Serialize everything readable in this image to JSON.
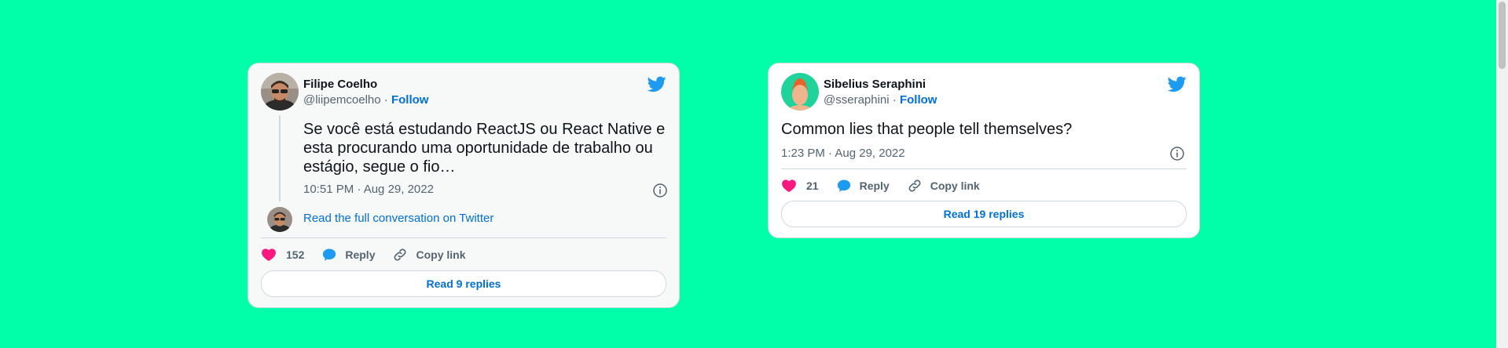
{
  "tweets": [
    {
      "name": "Filipe Coelho",
      "handle": "@liipemcoelho",
      "separator": "·",
      "follow": "Follow",
      "text": "Se você está estudando ReactJS ou React Native e esta procurando uma oportunidade de trabalho ou estágio, segue o fio…",
      "time": "10:51 PM · Aug 29, 2022",
      "conversation_link": "Read the full conversation on Twitter",
      "likes": "152",
      "reply": "Reply",
      "copy_link": "Copy link",
      "read_replies": "Read 9 replies"
    },
    {
      "name": "Sibelius Seraphini",
      "handle": "@sseraphini",
      "separator": "·",
      "follow": "Follow",
      "text": "Common lies that people tell themselves?",
      "time": "1:23 PM · Aug 29, 2022",
      "likes": "21",
      "reply": "Reply",
      "copy_link": "Copy link",
      "read_replies": "Read 19 replies"
    }
  ],
  "colors": {
    "background": "#00ffa8",
    "twitter_blue": "#1d9bf0",
    "link_blue": "#006fd6",
    "like_pink": "#f91880",
    "muted": "#536471"
  },
  "icons": [
    "twitter-bird-icon",
    "heart-icon",
    "reply-bubble-icon",
    "link-icon",
    "info-icon"
  ]
}
